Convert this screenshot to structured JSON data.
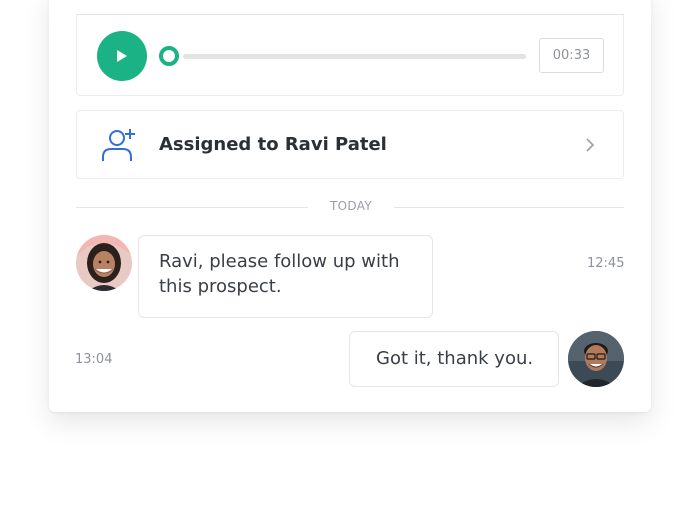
{
  "audio_player": {
    "play_icon": "play-icon",
    "progress": 0,
    "duration": "00:33",
    "accent_color": "#1bb286"
  },
  "assignment": {
    "icon": "add-user-icon",
    "label": "Assigned to Ravi Patel",
    "chevron_icon": "chevron-right-icon"
  },
  "date_divider": "TODAY",
  "messages": [
    {
      "direction": "incoming",
      "avatar": "woman-avatar",
      "text": "Ravi, please follow up with this prospect.",
      "time": "12:45"
    },
    {
      "direction": "outgoing",
      "avatar": "man-avatar",
      "text": "Got it, thank you.",
      "time": "13:04"
    }
  ]
}
